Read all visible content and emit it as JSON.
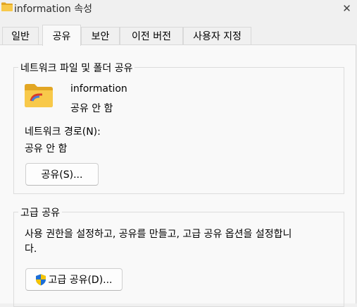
{
  "window": {
    "title": "information 속성",
    "close_glyph": "✕"
  },
  "tabs": [
    {
      "label": "일반",
      "active": false
    },
    {
      "label": "공유",
      "active": true
    },
    {
      "label": "보안",
      "active": false
    },
    {
      "label": "이전 버전",
      "active": false
    },
    {
      "label": "사용자 지정",
      "active": false
    }
  ],
  "network_sharing": {
    "legend": "네트워크 파일 및 폴더 공유",
    "folder_name": "information",
    "share_status": "공유 안 함",
    "network_path_label": "네트워크 경로(N):",
    "network_path_value": "공유 안 함",
    "share_button": "공유(S)..."
  },
  "advanced_sharing": {
    "legend": "고급 공유",
    "description_line1": "사용 권한을 설정하고, 공유를 만들고, 고급 공유 옵션을 설정합니",
    "description_line2": "다.",
    "button": "고급 공유(D)...",
    "button_icon": "uac-shield-icon"
  },
  "colors": {
    "folder_yellow": "#f8c94a",
    "folder_dark": "#e2a623",
    "shield_blue": "#1c6ed6",
    "shield_yellow": "#f5c400"
  }
}
